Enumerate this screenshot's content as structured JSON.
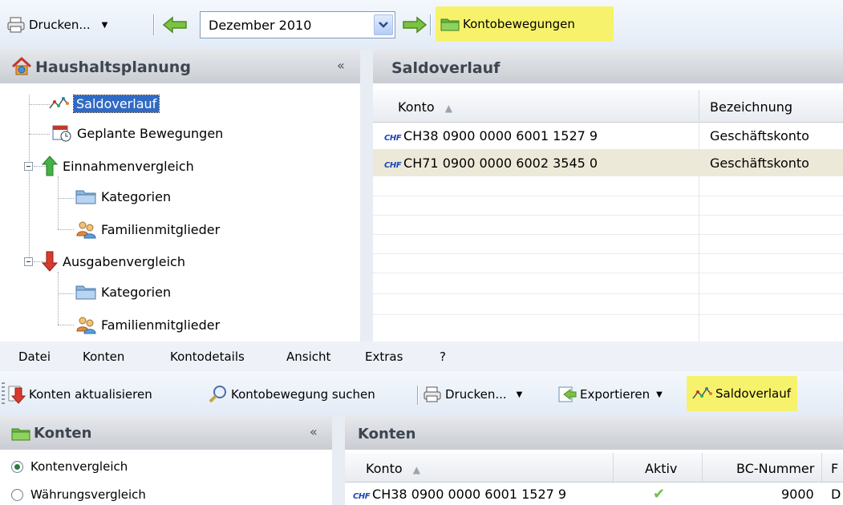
{
  "top_toolbar": {
    "print_label": "Drucken...",
    "month_value": "Dezember 2010",
    "kontobewegungen_label": "Kontobewegungen"
  },
  "nav": {
    "title": "Haushaltsplanung",
    "collapse": "«",
    "items": [
      {
        "label": "Saldoverlauf"
      },
      {
        "label": "Geplante Bewegungen"
      },
      {
        "label": "Einnahmenvergleich"
      },
      {
        "label": "Kategorien"
      },
      {
        "label": "Familienmitglieder"
      },
      {
        "label": "Ausgabenvergleich"
      },
      {
        "label": "Kategorien"
      },
      {
        "label": "Familienmitglieder"
      }
    ]
  },
  "saldo": {
    "title": "Saldoverlauf",
    "columns": [
      "Konto",
      "Bezeichnung"
    ],
    "rows": [
      {
        "currency": "CHF",
        "konto": "CH38 0900 0000 6001 1527 9",
        "bezeichnung": "Geschäftskonto"
      },
      {
        "currency": "CHF",
        "konto": "CH71 0900 0000 6002 3545 0",
        "bezeichnung": "Geschäftskonto"
      }
    ]
  },
  "menu": {
    "items": [
      "Datei",
      "Konten",
      "Kontodetails",
      "Ansicht",
      "Extras",
      "?"
    ]
  },
  "bottom_toolbar": {
    "refresh_label": "Konten aktualisieren",
    "search_label": "Kontobewegung suchen",
    "print_label": "Drucken...",
    "export_label": "Exportieren",
    "saldo_label": "Saldoverlauf"
  },
  "konten_nav": {
    "title": "Konten",
    "collapse": "«",
    "options": [
      {
        "label": "Kontenvergleich",
        "selected": true
      },
      {
        "label": "Währungsvergleich",
        "selected": false
      }
    ]
  },
  "konten": {
    "title": "Konten",
    "columns": [
      "Konto",
      "Aktiv",
      "BC-Nummer",
      "F"
    ],
    "rows": [
      {
        "currency": "CHF",
        "konto": "CH38 0900 0000 6001 1527 9",
        "aktiv": "✔",
        "bc": "9000",
        "f": "D"
      }
    ]
  },
  "colors": {
    "highlight": "#f7f26b",
    "selection": "#316ac5",
    "row_alt": "#ece9d8"
  }
}
